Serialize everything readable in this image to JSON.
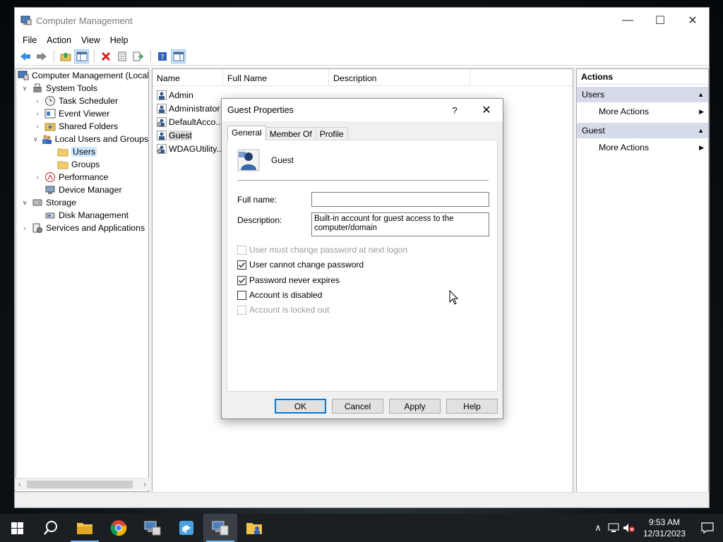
{
  "window": {
    "title": "Computer Management",
    "controls": {
      "minimize": "—",
      "maximize": "☐",
      "close": "✕"
    }
  },
  "menu": [
    "File",
    "Action",
    "View",
    "Help"
  ],
  "tree": {
    "root": "Computer Management (Local",
    "system_tools": "System Tools",
    "task_scheduler": "Task Scheduler",
    "event_viewer": "Event Viewer",
    "shared_folders": "Shared Folders",
    "local_users_groups": "Local Users and Groups",
    "users": "Users",
    "groups": "Groups",
    "performance": "Performance",
    "device_manager": "Device Manager",
    "storage": "Storage",
    "disk_management": "Disk Management",
    "services_apps": "Services and Applications"
  },
  "list": {
    "columns": [
      "Name",
      "Full Name",
      "Description"
    ],
    "users": [
      "Admin",
      "Administrator",
      "DefaultAcco...",
      "Guest",
      "WDAGUtility..."
    ]
  },
  "actions": {
    "header": "Actions",
    "section1": "Users",
    "section1_action": "More Actions",
    "section2": "Guest",
    "section2_action": "More Actions"
  },
  "dialog": {
    "title": "Guest Properties",
    "help": "?",
    "close": "✕",
    "tabs": [
      "General",
      "Member Of",
      "Profile"
    ],
    "username": "Guest",
    "full_name_label": "Full name:",
    "full_name_value": "",
    "description_label": "Description:",
    "description_value": "Built-in account for guest access to the computer/domain",
    "checkboxes": [
      {
        "label": "User must change password at next logon",
        "checked": false,
        "disabled": true
      },
      {
        "label": "User cannot change password",
        "checked": true,
        "disabled": false
      },
      {
        "label": "Password never expires",
        "checked": true,
        "disabled": false
      },
      {
        "label": "Account is disabled",
        "checked": false,
        "disabled": false
      },
      {
        "label": "Account is locked out",
        "checked": false,
        "disabled": true
      }
    ],
    "buttons": {
      "ok": "OK",
      "cancel": "Cancel",
      "apply": "Apply",
      "help": "Help"
    }
  },
  "taskbar": {
    "time": "9:53 AM",
    "date": "12/31/2023"
  }
}
